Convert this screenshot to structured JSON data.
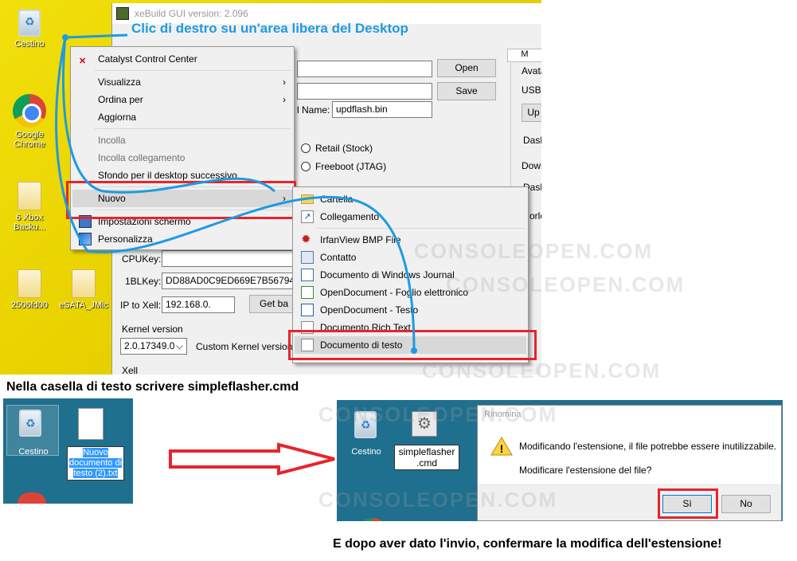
{
  "desktop": {
    "icons": [
      {
        "label": "Cestino"
      },
      {
        "label": "Google Chrome"
      },
      {
        "label": "6 Xbox Backu..."
      },
      {
        "label": "2506fd00"
      },
      {
        "label": "eSATA_JMic"
      }
    ]
  },
  "instructions": {
    "step1": "Clic di destro su un'area libera del Desktop",
    "step2": "Nella casella di testo scrivere simpleflasher.cmd",
    "step3": "E dopo aver dato l'invio, confermare la modifica dell'estensione!"
  },
  "xebuild": {
    "title": "xeBuild GUI version: 2.096",
    "open_label": "Open",
    "save_label": "Save",
    "name_label": "l Name:",
    "name_value": "updflash.bin",
    "retail_label": "Retail (Stock)",
    "freeboot_label": "Freeboot (JTAG)",
    "cpukey_label": "CPUKey:",
    "cpukey_value": "",
    "onebl_label": "1BLKey:",
    "onebl_value": "DD88AD0C9ED669E7B56794FB",
    "ip_label": "IP to Xell:",
    "ip_value": "192.168.0.",
    "getbase_label": "Get ba",
    "kernel_label": "Kernel version",
    "kernel_value": "2.0.17349.0",
    "custom_kernel_label": "Custom Kernel version:",
    "xell_label": "Xell",
    "right_tab_label": "M",
    "right_items": [
      "Avata",
      "USB",
      "Up",
      "Dash",
      "Down",
      "Dash",
      "orlo"
    ]
  },
  "context_menu": {
    "items": [
      {
        "label": "Catalyst Control Center",
        "icon": "catalyst-icon"
      },
      {
        "label": "Visualizza",
        "submenu": true
      },
      {
        "label": "Ordina per",
        "submenu": true
      },
      {
        "label": "Aggiorna"
      },
      {
        "label": "Incolla",
        "disabled": true
      },
      {
        "label": "Incolla collegamento",
        "disabled": true
      },
      {
        "label": "Sfondo per il desktop successivo"
      },
      {
        "label": "Nuovo",
        "submenu": true
      },
      {
        "label": "Impostazioni schermo",
        "icon": "display-icon"
      },
      {
        "label": "Personalizza",
        "icon": "personalize-icon"
      }
    ]
  },
  "submenu": {
    "items": [
      {
        "label": "Cartella",
        "icon": "folder-icon"
      },
      {
        "label": "Collegamento",
        "icon": "shortcut-icon"
      },
      {
        "label": "IrfanView BMP File",
        "icon": "irfanview-icon"
      },
      {
        "label": "Contatto",
        "icon": "contact-icon"
      },
      {
        "label": "Documento di Windows Journal",
        "icon": "journal-icon"
      },
      {
        "label": "OpenDocument - Foglio elettronico",
        "icon": "spreadsheet-icon"
      },
      {
        "label": "OpenDocument - Testo",
        "icon": "odt-icon"
      },
      {
        "label": "Documento Rich Text",
        "icon": "rtf-icon"
      },
      {
        "label": "Documento di testo",
        "icon": "text-document-icon"
      }
    ]
  },
  "rename_example": {
    "bin_label": "Cestino",
    "file_label": "Nuovo documento di testo (2).txt"
  },
  "rename_dialog": {
    "bin_label": "Cestino",
    "file_label": "simpleflasher .cmd",
    "title": "Rinomina",
    "message": "Modificando l'estensione, il file potrebbe essere inutilizzabile.",
    "question": "Modificare l'estensione del file?",
    "yes_label": "Sì",
    "no_label": "No"
  },
  "watermark": "CONSOLEOPEN.COM",
  "colors": {
    "highlight_red": "#e8242b",
    "arrow_blue": "#1e9ae0",
    "desktop_yellow": "#e8d200",
    "desktop_teal": "#1f6f8e"
  }
}
